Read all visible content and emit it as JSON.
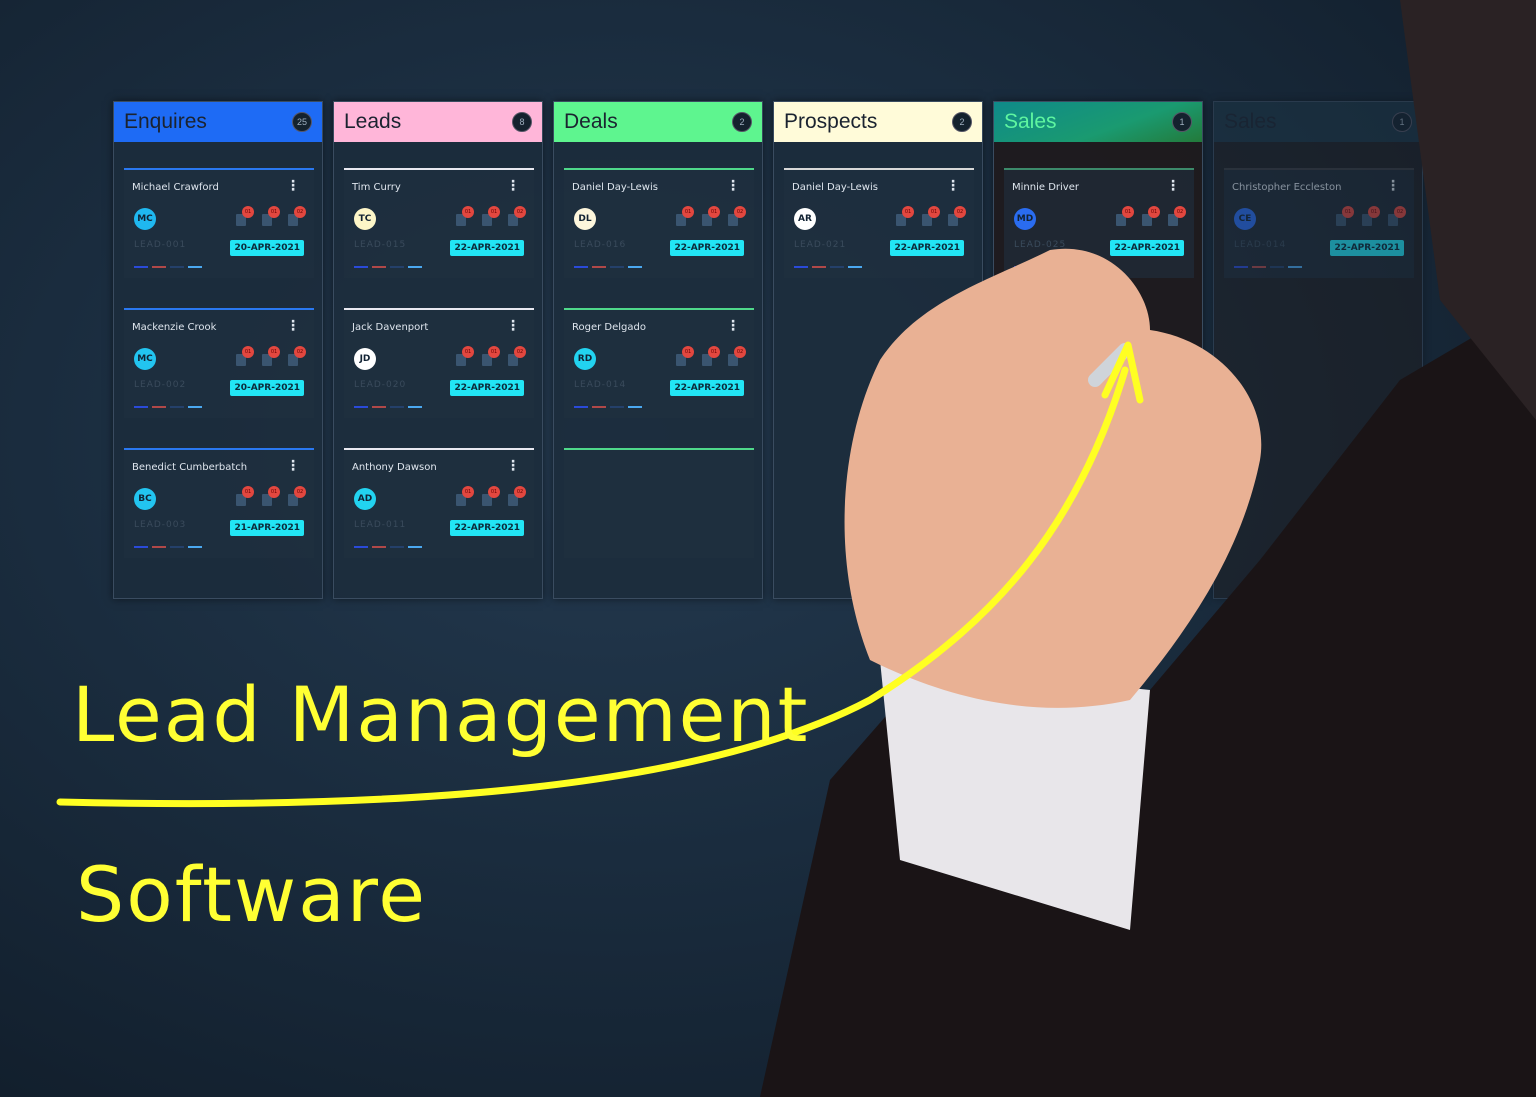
{
  "columns": [
    {
      "title": "Enquires",
      "count": "25",
      "color": "#1e6bf5",
      "line": "#2a78f0",
      "cards": [
        {
          "name": "Michael Crawford",
          "initials": "MC",
          "avatar": "#1fb8f0",
          "lead": "LEAD-001",
          "date": "20-APR-2021"
        },
        {
          "name": "Mackenzie Crook",
          "initials": "MC",
          "avatar": "#22c4f0",
          "lead": "LEAD-002",
          "date": "20-APR-2021"
        },
        {
          "name": "Benedict Cumberbatch",
          "initials": "BC",
          "avatar": "#22c4f0",
          "lead": "LEAD-003",
          "date": "21-APR-2021"
        }
      ]
    },
    {
      "title": "Leads",
      "count": "8",
      "color": "#ffb6d9",
      "line": "#e8e8f0",
      "cards": [
        {
          "name": "Tim Curry",
          "initials": "TC",
          "avatar": "#fdf6c8",
          "lead": "LEAD-015",
          "date": "22-APR-2021"
        },
        {
          "name": "Jack Davenport",
          "initials": "JD",
          "avatar": "#ffffff",
          "lead": "LEAD-020",
          "date": "22-APR-2021"
        },
        {
          "name": "Anthony Dawson",
          "initials": "AD",
          "avatar": "#22d3f0",
          "lead": "LEAD-011",
          "date": "22-APR-2021"
        }
      ]
    },
    {
      "title": "Deals",
      "count": "2",
      "color": "#5ef58f",
      "line": "#4fd88a",
      "cards": [
        {
          "name": "Daniel Day-Lewis",
          "initials": "DL",
          "avatar": "#fdf6dc",
          "lead": "LEAD-016",
          "date": "22-APR-2021"
        },
        {
          "name": "Roger Delgado",
          "initials": "RD",
          "avatar": "#22d3f0",
          "lead": "LEAD-014",
          "date": "22-APR-2021"
        }
      ]
    },
    {
      "title": "Prospects",
      "count": "2",
      "color": "#fffbd9",
      "line": "#d8d8d8",
      "cards": [
        {
          "name": "Daniel Day-Lewis",
          "initials": "AR",
          "avatar": "#ffffff",
          "lead": "LEAD-021",
          "date": "22-APR-2021"
        }
      ]
    },
    {
      "title": "Sales",
      "count": "1",
      "color": "linear-gradient(160deg,#0f8a8a,#1a9a70 60%,#237a3a)",
      "line": "#3c8a6a",
      "cards": [
        {
          "name": "Minnie Driver",
          "initials": "MD",
          "avatar": "#2a6cf0",
          "lead": "LEAD-025",
          "date": "22-APR-2021"
        }
      ]
    },
    {
      "title": "Sales",
      "count": "1",
      "color": "#1c3444",
      "line": "#3a3a40",
      "cards": [
        {
          "name": "Christopher Eccleston",
          "initials": "CE",
          "avatar": "#2a6cf0",
          "lead": "LEAD-014",
          "date": "22-APR-2021"
        }
      ]
    }
  ],
  "badges": [
    "01",
    "01",
    "02"
  ],
  "headline": {
    "line1": "Lead Management",
    "line2": "Software",
    "color": "#ffff33"
  }
}
